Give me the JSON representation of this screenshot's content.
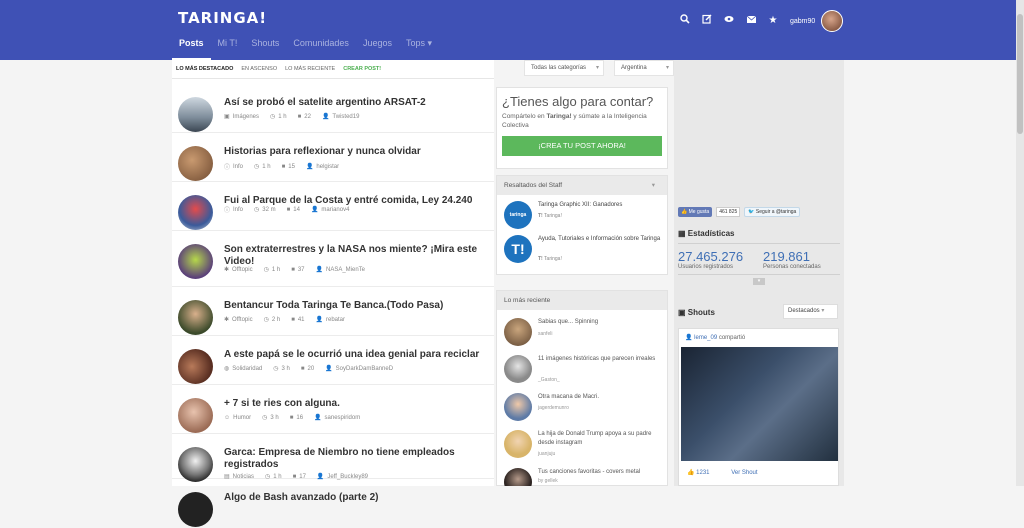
{
  "header": {
    "logo": "TARINGA!",
    "tabs": [
      {
        "label": "Posts",
        "active": true
      },
      {
        "label": "Mi T!"
      },
      {
        "label": "Shouts"
      },
      {
        "label": "Comunidades"
      },
      {
        "label": "Juegos"
      },
      {
        "label": "Tops ▾"
      }
    ],
    "icons": [
      "search-icon",
      "edit-icon",
      "eye-icon",
      "mail-icon",
      "star-icon"
    ],
    "username": "gabm90",
    "accent": "#3f51b5"
  },
  "filters": {
    "items": [
      "LO MÁS DESTACADO",
      "EN ASCENSO",
      "LO MÁS RECIENTE",
      "CREAR POST!"
    ],
    "category_select": "Todas las categorías",
    "country_select": "Argentina"
  },
  "posts": [
    {
      "title": "Así se probó el satelite argentino ARSAT-2",
      "category": "Imágenes",
      "time": "1 h",
      "comments": "22",
      "author": "Twisted19"
    },
    {
      "title": "Historias para reflexionar y nunca olvidar",
      "category": "Info",
      "time": "1 h",
      "comments": "15",
      "author": "helgistar"
    },
    {
      "title": "Fui al Parque de la Costa y entré comida, Ley 24.240",
      "category": "Info",
      "time": "32 m",
      "comments": "14",
      "author": "marianov4"
    },
    {
      "title": "Son extraterrestres y la NASA nos miente? ¡Mira este Video!",
      "category": "Offtopic",
      "time": "1 h",
      "comments": "37",
      "author": "NASA_MienTe"
    },
    {
      "title": "Bentancur Toda Taringa Te Banca.(Todo Pasa)",
      "category": "Offtopic",
      "time": "2 h",
      "comments": "41",
      "author": "rebatar"
    },
    {
      "title": "A este papá se le ocurrió una idea genial para reciclar",
      "category": "Solidaridad",
      "time": "3 h",
      "comments": "20",
      "author": "SoyDarkDamBanneD"
    },
    {
      "title": "+ 7 si te ries con alguna.",
      "category": "Humor",
      "time": "3 h",
      "comments": "16",
      "author": "sanespiridom"
    },
    {
      "title": "Garca: Empresa de Niembro no tiene empleados registrados",
      "category": "Noticias",
      "time": "1 h",
      "comments": "17",
      "author": "Jeff_Buckley89"
    },
    {
      "title": "Algo de Bash avanzado (parte 2)"
    }
  ],
  "promo": {
    "question": "¿Tienes algo para contar?",
    "text_before": "Compártelo en ",
    "brand": "Taringa!",
    "text_after": " y súmate a la Inteligencia Colectiva",
    "button": "¡CREA TU POST AHORA!"
  },
  "staff": {
    "header": "Resaltados del Staff",
    "items": [
      {
        "title": "Taringa Graphic XII: Ganadores",
        "source": "Taringa!"
      },
      {
        "title": "Ayuda, Tutoriales e Información sobre Taringa",
        "source": "Taringa!"
      }
    ]
  },
  "recent": {
    "header": "Lo más reciente",
    "items": [
      {
        "title": "Sabias que... Spinning",
        "user": "sanfeli"
      },
      {
        "title": "11 imágenes históricas que parecen irreales",
        "user": "_Gaston_"
      },
      {
        "title": "Otra macana de Macri.",
        "user": "jagerdemunro"
      },
      {
        "title": "La hija de Donald Trump apoya a su padre desde instagram",
        "user": "juanjuju"
      },
      {
        "title": "Tus canciones favoritas - covers metal",
        "user": "by gellek"
      }
    ]
  },
  "sidebar": {
    "like": "Me gusta",
    "like_count": "461 825",
    "follow": "Seguir a @taringa",
    "stats_title": "Estadísticas",
    "users_value": "27.465.276",
    "users_label": "Usuarios registrados",
    "online_value": "219.861",
    "online_label": "Personas conectadas",
    "shouts_title": "Shouts",
    "shouts_select": "Destacados",
    "shout_user": "leme_09",
    "shout_action": "compartió",
    "shout_likes": "1231",
    "shout_link": "Ver Shout"
  }
}
